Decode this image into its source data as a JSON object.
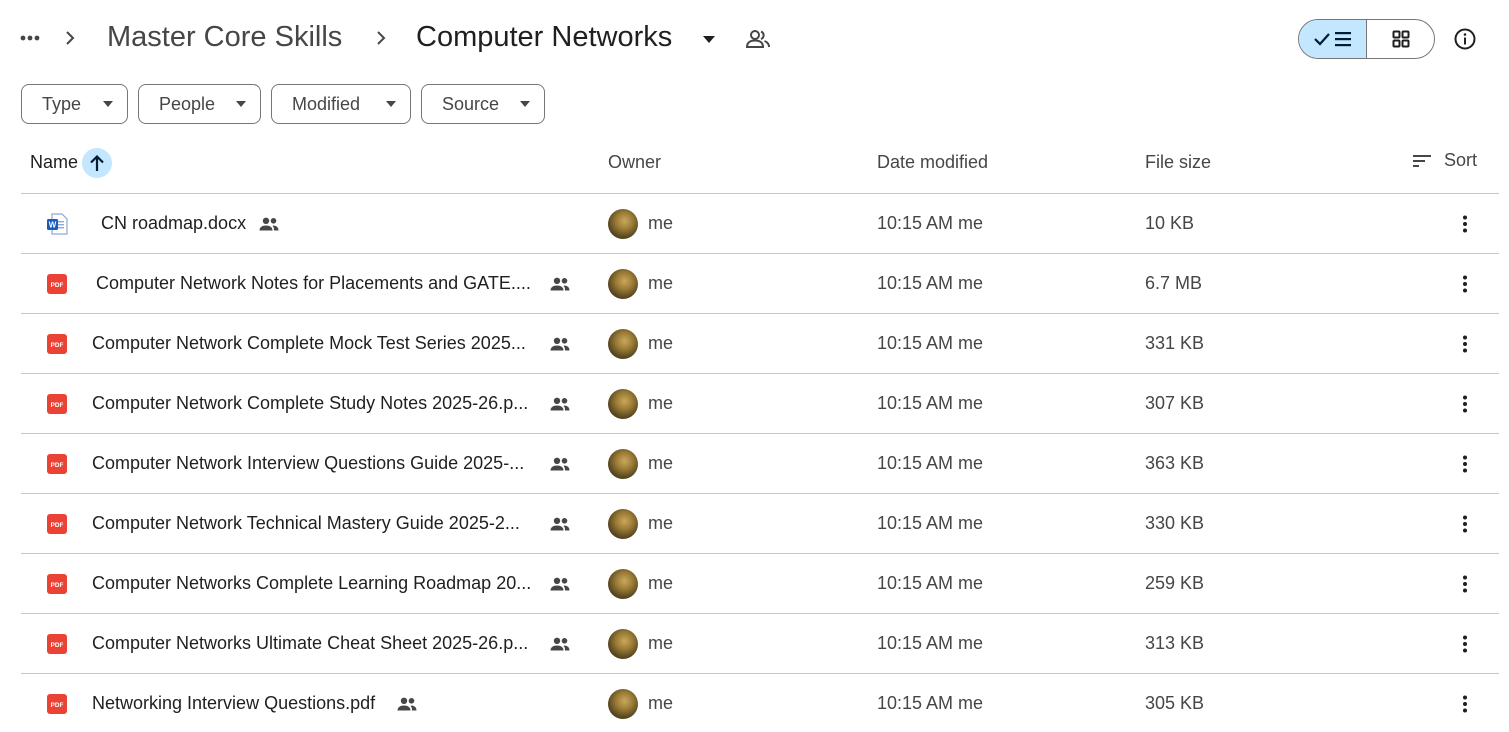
{
  "breadcrumb": {
    "items": [
      "Master Core Skills",
      "Computer Networks"
    ]
  },
  "filters": [
    "Type",
    "People",
    "Modified",
    "Source"
  ],
  "table": {
    "headers": {
      "name": "Name",
      "owner": "Owner",
      "modified": "Date modified",
      "size": "File size",
      "sort": "Sort"
    },
    "rows": [
      {
        "type": "docx",
        "name": "CN roadmap.docx",
        "owner": "me",
        "modified": "10:15 AM me",
        "size": "10 KB"
      },
      {
        "type": "pdf",
        "name": "Computer Network Notes for Placements and GATE....",
        "owner": "me",
        "modified": "10:15 AM me",
        "size": "6.7 MB"
      },
      {
        "type": "pdf",
        "name": "Computer Network Complete Mock Test Series 2025...",
        "owner": "me",
        "modified": "10:15 AM me",
        "size": "331 KB"
      },
      {
        "type": "pdf",
        "name": "Computer Network Complete Study Notes 2025-26.p...",
        "owner": "me",
        "modified": "10:15 AM me",
        "size": "307 KB"
      },
      {
        "type": "pdf",
        "name": "Computer Network Interview Questions Guide 2025-...",
        "owner": "me",
        "modified": "10:15 AM me",
        "size": "363 KB"
      },
      {
        "type": "pdf",
        "name": "Computer Network Technical Mastery Guide 2025-2...",
        "owner": "me",
        "modified": "10:15 AM me",
        "size": "330 KB"
      },
      {
        "type": "pdf",
        "name": "Computer Networks Complete Learning Roadmap 20...",
        "owner": "me",
        "modified": "10:15 AM me",
        "size": "259 KB"
      },
      {
        "type": "pdf",
        "name": "Computer Networks Ultimate Cheat Sheet 2025-26.p...",
        "owner": "me",
        "modified": "10:15 AM me",
        "size": "313 KB"
      },
      {
        "type": "pdf",
        "name": "Networking Interview Questions.pdf",
        "owner": "me",
        "modified": "10:15 AM me",
        "size": "305 KB"
      }
    ]
  },
  "icons": {
    "pdf_label": "PDF",
    "word_label": "W"
  },
  "colors": {
    "accent": "#c2e7ff",
    "pdf_red": "#ea4335",
    "word_blue": "#185abd"
  }
}
